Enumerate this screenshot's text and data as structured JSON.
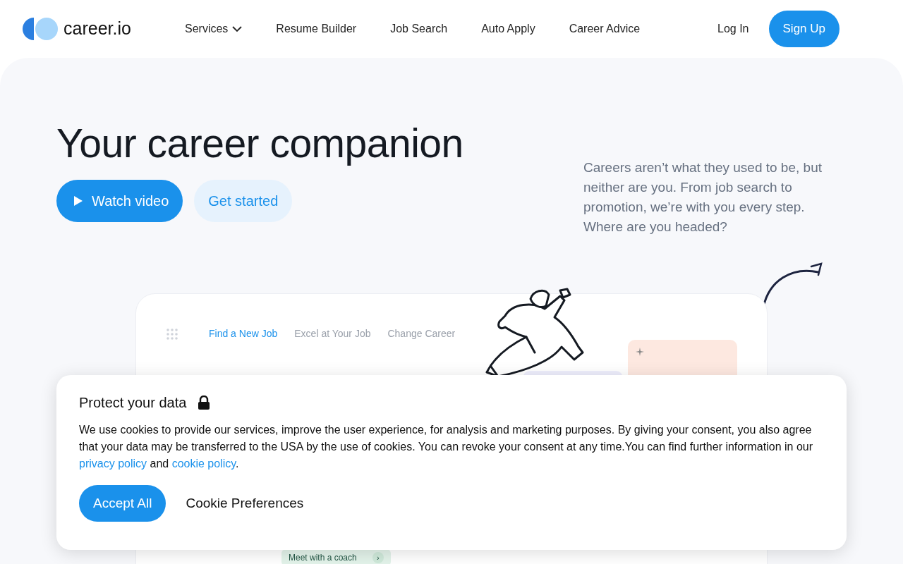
{
  "nav": {
    "logo": "career.io",
    "links": [
      {
        "label": "Services",
        "dropdown": true
      },
      {
        "label": "Resume Builder",
        "dropdown": false
      },
      {
        "label": "Job Search",
        "dropdown": false
      },
      {
        "label": "Auto Apply",
        "dropdown": false
      },
      {
        "label": "Career Advice",
        "dropdown": false
      }
    ],
    "login": "Log In",
    "signup": "Sign Up"
  },
  "hero": {
    "title": "Your career companion",
    "watch_button": "Watch video",
    "start_button": "Get started",
    "tagline": "Careers aren’t what they used to be, but neither are you. From job search to promotion, we’re with you every step. Where are you headed?"
  },
  "mockup": {
    "tabs": [
      {
        "label": "Find a New Job",
        "selected": true
      },
      {
        "label": "Excel at Your Job",
        "selected": false
      },
      {
        "label": "Change Career",
        "selected": false
      }
    ],
    "chip": "Meet with a coach",
    "chip_arrow": "›"
  },
  "cookie": {
    "title": "Protect your data",
    "text_before": "We use cookies to provide our services, improve the user experience, for analysis and marketing purposes. By giving your consent, you also agree that your data may be transferred to the USA by the use of cookies. You can revoke your consent at any time.You can find further information in our ",
    "privacy_link": "privacy policy",
    "text_middle": " and ",
    "cookie_link": "cookie policy",
    "text_after": ".",
    "accept": "Accept All",
    "preferences": "Cookie Preferences"
  }
}
